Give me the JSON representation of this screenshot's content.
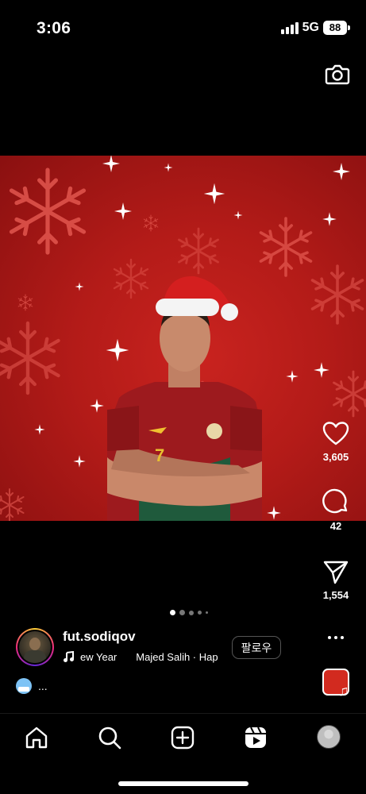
{
  "status_bar": {
    "time": "3:06",
    "network": "5G",
    "battery": "88"
  },
  "post": {
    "likes": "3,605",
    "comments": "42",
    "shares": "1,554",
    "carousel_pages": 5,
    "carousel_active": 1
  },
  "author": {
    "username": "fut.sodiqov",
    "audio_track": "ew Year",
    "audio_artist": "Majed Salih · Hap",
    "follow_label": "팔로우"
  },
  "caption": {
    "text": "..."
  },
  "colors": {
    "background": "#000000",
    "image_red": "#b31b18",
    "muted_text": "#777777"
  },
  "icons": {
    "camera": "camera-icon",
    "like": "heart-icon",
    "comment": "comment-icon",
    "share": "send-icon",
    "more": "more-icon",
    "music": "music-note-icon",
    "home": "home-icon",
    "search": "search-icon",
    "create": "plus-square-icon",
    "reels": "reels-icon",
    "profile": "avatar"
  }
}
